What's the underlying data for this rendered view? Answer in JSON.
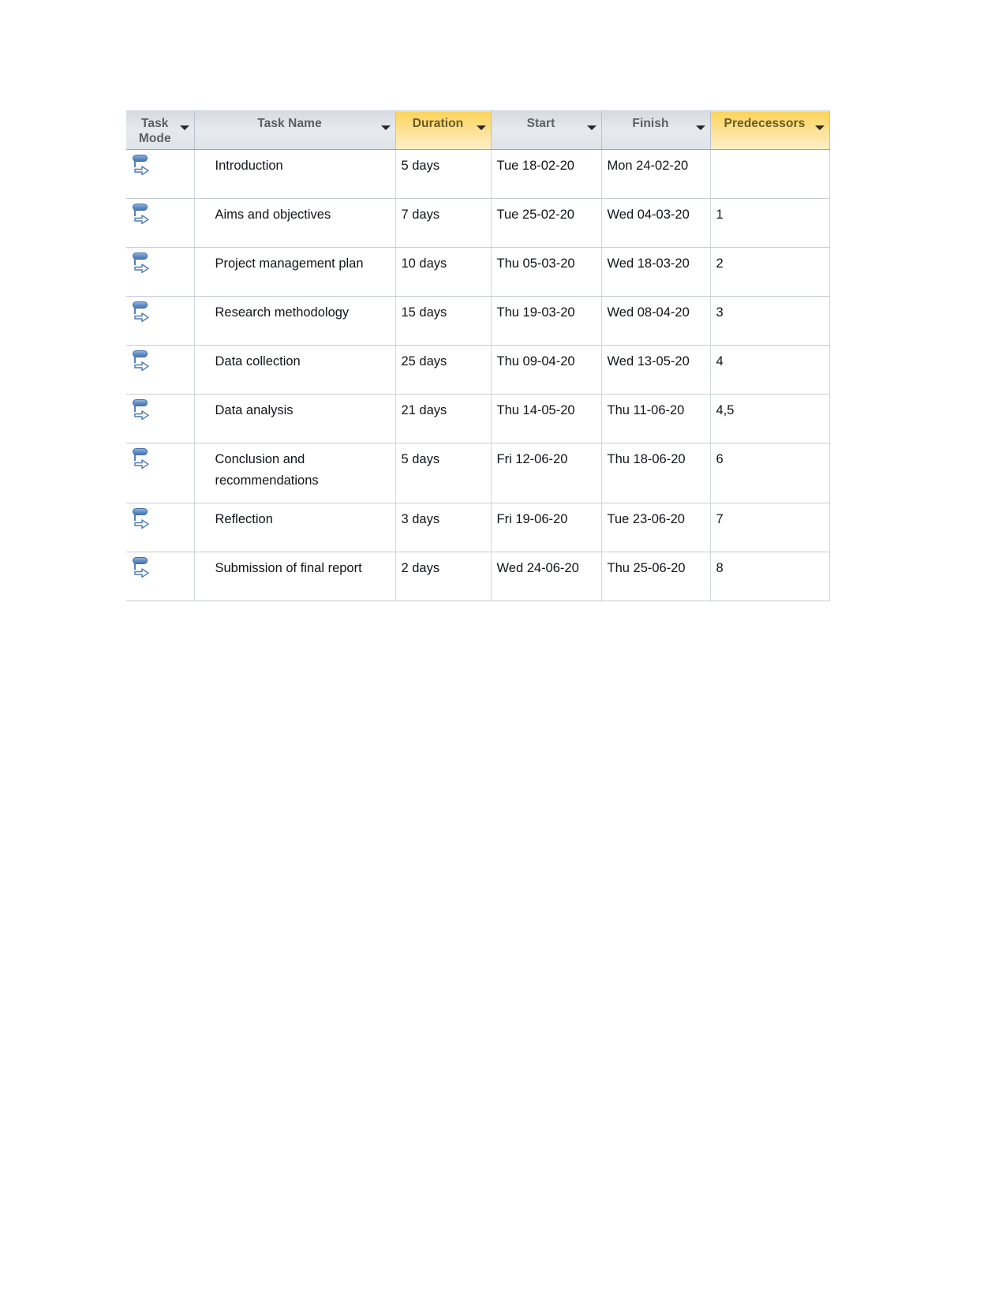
{
  "table": {
    "columns": [
      {
        "key": "task_mode",
        "label": "Task\nMode",
        "highlight": false,
        "filter_icon": "chevron-down-icon"
      },
      {
        "key": "task_name",
        "label": "Task Name",
        "highlight": false,
        "filter_icon": "chevron-down-icon"
      },
      {
        "key": "duration",
        "label": "Duration",
        "highlight": true,
        "filter_icon": "chevron-down-icon"
      },
      {
        "key": "start",
        "label": "Start",
        "highlight": false,
        "filter_icon": "chevron-down-icon"
      },
      {
        "key": "finish",
        "label": "Finish",
        "highlight": false,
        "filter_icon": "chevron-down-icon"
      },
      {
        "key": "predecessors",
        "label": "Predecessors",
        "highlight": true,
        "filter_icon": "chevron-down-icon"
      }
    ],
    "rows": [
      {
        "task_mode_icon": "auto-scheduled-task-icon",
        "task_name": "Introduction",
        "duration": "5 days",
        "start": "Tue 18-02-20",
        "finish": "Mon 24-02-20",
        "predecessors": ""
      },
      {
        "task_mode_icon": "auto-scheduled-task-icon",
        "task_name": "Aims and objectives",
        "duration": "7 days",
        "start": "Tue 25-02-20",
        "finish": "Wed 04-03-20",
        "predecessors": "1"
      },
      {
        "task_mode_icon": "auto-scheduled-task-icon",
        "task_name": "Project management plan",
        "duration": "10 days",
        "start": "Thu 05-03-20",
        "finish": "Wed 18-03-20",
        "predecessors": "2"
      },
      {
        "task_mode_icon": "auto-scheduled-task-icon",
        "task_name": "Research methodology",
        "duration": "15 days",
        "start": "Thu 19-03-20",
        "finish": "Wed 08-04-20",
        "predecessors": "3"
      },
      {
        "task_mode_icon": "auto-scheduled-task-icon",
        "task_name": "Data collection",
        "duration": "25 days",
        "start": "Thu 09-04-20",
        "finish": "Wed 13-05-20",
        "predecessors": "4"
      },
      {
        "task_mode_icon": "auto-scheduled-task-icon",
        "task_name": "Data analysis",
        "duration": "21 days",
        "start": "Thu 14-05-20",
        "finish": "Thu 11-06-20",
        "predecessors": "4,5"
      },
      {
        "task_mode_icon": "auto-scheduled-task-icon",
        "task_name": "Conclusion and recommendations",
        "duration": "5 days",
        "start": "Fri 12-06-20",
        "finish": "Thu 18-06-20",
        "predecessors": "6"
      },
      {
        "task_mode_icon": "auto-scheduled-task-icon",
        "task_name": "Reflection",
        "duration": "3 days",
        "start": "Fri 19-06-20",
        "finish": "Tue 23-06-20",
        "predecessors": "7"
      },
      {
        "task_mode_icon": "auto-scheduled-task-icon",
        "task_name": "Submission of final report",
        "duration": "2 days",
        "start": "Wed 24-06-20",
        "finish": "Thu 25-06-20",
        "predecessors": "8"
      }
    ]
  },
  "colors": {
    "header_default_bg": "#e2e7ec",
    "header_highlight_bg": "#fcd45a",
    "header_text": "#5a5f66",
    "header_highlight_text": "#6b5a24",
    "cell_text": "#111418",
    "grid_line": "#c8cdd4",
    "task_mode_icon_blue": "#5f8cc4"
  }
}
